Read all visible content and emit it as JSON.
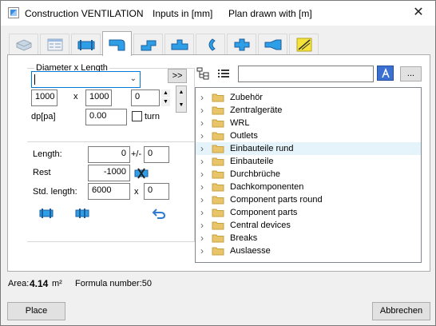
{
  "window": {
    "title": "Construction VENTILATION",
    "inputs_label": "Inputs in [mm]",
    "plan_label": "Plan drawn with  [m]",
    "close_glyph": "✕"
  },
  "tabs": [
    {
      "icon": "duct-outline-icon"
    },
    {
      "icon": "form-table-icon"
    },
    {
      "icon": "straight-duct-icon"
    },
    {
      "icon": "elbow-duct-icon"
    },
    {
      "icon": "offset-duct-icon"
    },
    {
      "icon": "tee-duct-icon"
    },
    {
      "icon": "bend-fitting-icon"
    },
    {
      "icon": "cross-fitting-icon"
    },
    {
      "icon": "reducer-icon"
    },
    {
      "icon": "diagonal-line-icon"
    }
  ],
  "form": {
    "group_legend": "Diameter  x  Length",
    "combo_value": "",
    "expand_button": ">>",
    "width_value": "1000",
    "x_label": "x",
    "height_value": "1000",
    "third_value": "0",
    "dp_label": "dp[pa]",
    "dp_value": "0.00",
    "turn_label": "turn",
    "turn_checked": false,
    "length_label": "Length:",
    "length_value": "0",
    "plusminus_label": "+/-",
    "plusminus_value": "0",
    "rest_label": "Rest",
    "rest_value": "-1000",
    "std_length_label": "Std. length:",
    "std_length_value": "6000",
    "std_x_label": "x",
    "std_count_value": "0"
  },
  "browser": {
    "search_value": "",
    "more_button": "...",
    "selected_index": 3,
    "items": [
      "Zubehör",
      "Zentralgeräte",
      "WRL",
      "Outlets",
      "Einbauteile rund",
      "Einbauteile",
      "Durchbrüche",
      "Dachkomponenten",
      "Component parts round",
      "Component parts",
      "Central devices",
      "Breaks",
      "Auslaesse"
    ]
  },
  "status": {
    "area_label": "Area:",
    "area_value": "4.14",
    "area_unit": "m²",
    "formula_label": "Formula number:50"
  },
  "buttons": {
    "place": "Place",
    "cancel": "Abbrechen"
  },
  "colors": {
    "accent": "#0078d7",
    "duct_blue": "#2e9fe6",
    "folder_yellow": "#e8c46a",
    "selection": "#e5f3fb"
  }
}
